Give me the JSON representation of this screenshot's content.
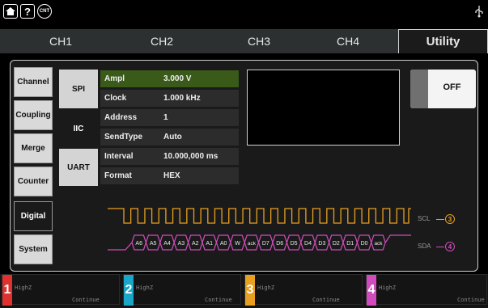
{
  "top_icons": {
    "home": "home-icon",
    "help": "?",
    "cnt": "CNT",
    "usb": "usb-icon"
  },
  "tabs": [
    "CH1",
    "CH2",
    "CH3",
    "CH4",
    "Utility"
  ],
  "sidebar": [
    "Channel",
    "Coupling",
    "Merge",
    "Counter",
    "Digital",
    "System"
  ],
  "protocols": [
    "SPI",
    "IIC",
    "UART"
  ],
  "params": [
    {
      "label": "Ampl",
      "value": "3.000 V"
    },
    {
      "label": "Clock",
      "value": "1.000 kHz"
    },
    {
      "label": "Address",
      "value": "1"
    },
    {
      "label": "SendType",
      "value": "Auto"
    },
    {
      "label": "Interval",
      "value": "10.000,000 ms"
    },
    {
      "label": "Format",
      "value": "HEX"
    }
  ],
  "output_button": "OFF",
  "waveform": {
    "scl_label": "SCL",
    "scl_channel": "3",
    "sda_label": "SDA",
    "sda_channel": "4",
    "sda_bits": [
      "A6",
      "A5",
      "A4",
      "A3",
      "A2",
      "A1",
      "A0",
      "W",
      "ack",
      "D7",
      "D6",
      "D5",
      "D4",
      "D3",
      "D2",
      "D1",
      "D0",
      "ack"
    ]
  },
  "channels": [
    {
      "num": "1",
      "state": "HighZ",
      "mode": "Continue",
      "color": "#e03030"
    },
    {
      "num": "2",
      "state": "HighZ",
      "mode": "Continue",
      "color": "#1aa6c8"
    },
    {
      "num": "3",
      "state": "HighZ",
      "mode": "Continue",
      "color": "#e8a020"
    },
    {
      "num": "4",
      "state": "HighZ",
      "mode": "Continue",
      "color": "#d04cbc"
    }
  ],
  "colors": {
    "scl": "#e8a020",
    "sda": "#d04cbc",
    "selected_param": "#3a5a1a"
  }
}
